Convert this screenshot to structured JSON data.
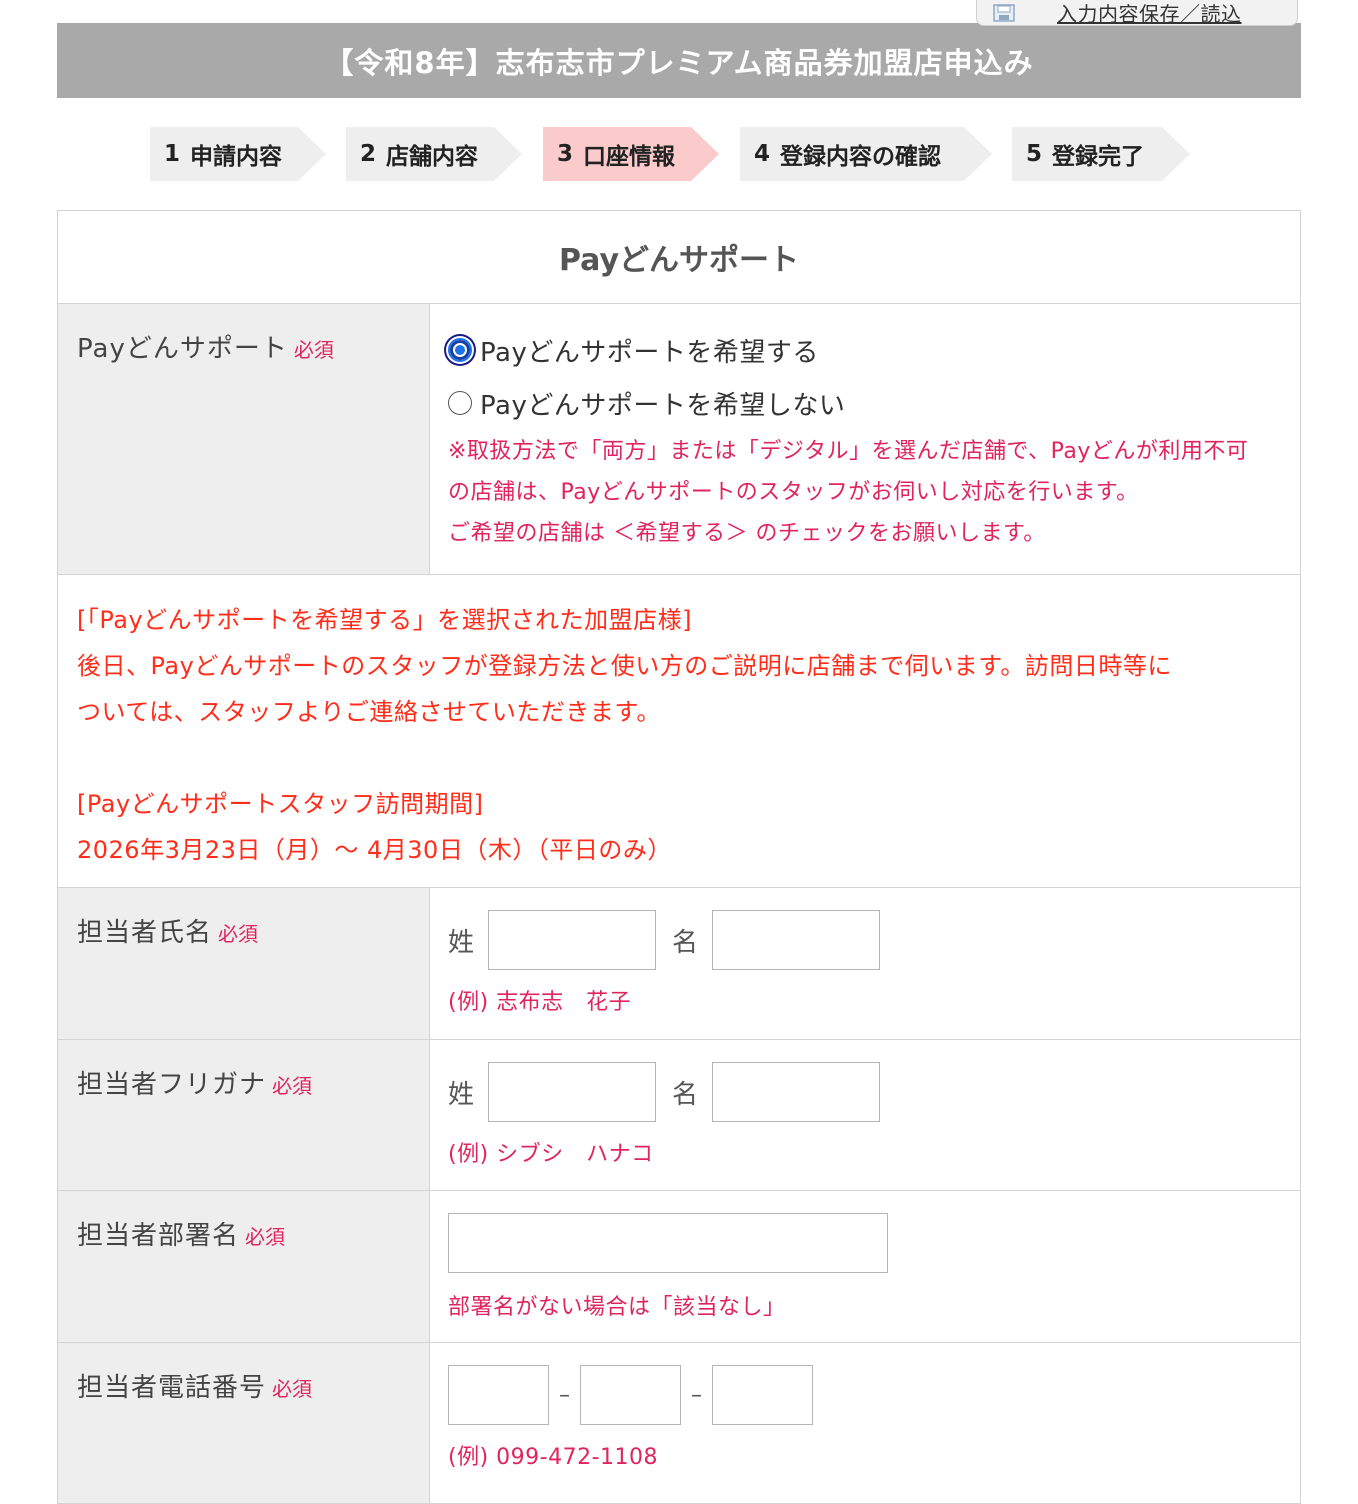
{
  "save_tab": {
    "icon": "floppy-disk-icon",
    "label": "入力内容保存／読込"
  },
  "header": {
    "title": "【令和8年】志布志市プレミアム商品券加盟店申込み"
  },
  "steps": [
    {
      "num": "1",
      "label": "申請内容",
      "active": false
    },
    {
      "num": "2",
      "label": "店舗内容",
      "active": false
    },
    {
      "num": "3",
      "label": "口座情報",
      "active": true
    },
    {
      "num": "4",
      "label": "登録内容の確認",
      "active": false
    },
    {
      "num": "5",
      "label": "登録完了",
      "active": false
    }
  ],
  "section": {
    "title": "Payどんサポート"
  },
  "required_label": "必須",
  "support": {
    "label": "Payどんサポート",
    "options": [
      {
        "label": "Payどんサポートを希望する",
        "checked": true
      },
      {
        "label": "Payどんサポートを希望しない",
        "checked": false
      }
    ],
    "note_1": "※取扱方法で「両方」または「デジタル」を選んだ店舗で、Payどんが利用不可",
    "note_2": "の店舗は、Payどんサポートのスタッフがお伺いし対応を行います。",
    "note_3": "ご希望の店舗は ＜希望する＞ のチェックをお願いします。"
  },
  "info": {
    "line_1": "[「Payどんサポートを希望する」を選択された加盟店様]",
    "line_2": "後日、Payどんサポートのスタッフが登録方法と使い方のご説明に店舗まで伺います。訪問日時等に",
    "line_3": "ついては、スタッフよりご連絡させていただきます。",
    "line_4": "[Payどんサポートスタッフ訪問期間]",
    "line_5": "2026年3月23日（月）〜 4月30日（木）（平日のみ）"
  },
  "contact_name": {
    "label": "担当者氏名",
    "sei": "姓",
    "mei": "名",
    "sei_value": "",
    "mei_value": "",
    "example": "(例) 志布志　花子"
  },
  "contact_kana": {
    "label": "担当者フリガナ",
    "sei": "姓",
    "mei": "名",
    "sei_value": "",
    "mei_value": "",
    "example": "(例) シブシ　ハナコ"
  },
  "department": {
    "label": "担当者部署名",
    "value": "",
    "note": "部署名がない場合は「該当なし」"
  },
  "phone": {
    "label": "担当者電話番号",
    "separator": "–",
    "values": [
      "",
      "",
      ""
    ],
    "example": "(例) 099-472-1108"
  },
  "colors": {
    "header_bg": "#a9a9a9",
    "step_active": "#fbcaca",
    "required": "#e0245e",
    "info_text": "#ff2d1a"
  }
}
